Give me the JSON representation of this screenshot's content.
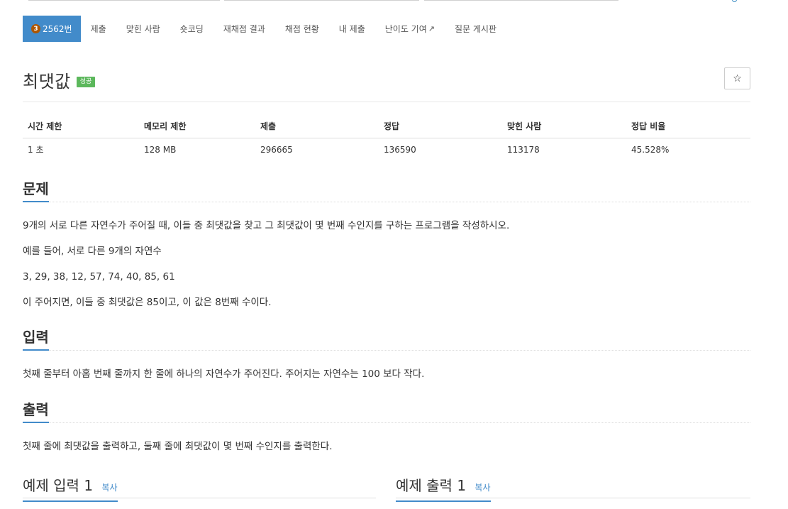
{
  "nav": {
    "tier_label": "3",
    "problem_number": "2562번",
    "items": [
      "제출",
      "맞힌 사람",
      "숏코딩",
      "재채점 결과",
      "채점 현황",
      "내 제출",
      "난이도 기여",
      "질문 게시판"
    ],
    "external_icon": "external-link-icon",
    "active_color": "#428bca",
    "tier_color": "#ad5600"
  },
  "problem": {
    "title": "최댓값",
    "badge": "성공",
    "badge_color": "#5cb85c",
    "star_label": "☆"
  },
  "stats": {
    "headers": [
      "시간 제한",
      "메모리 제한",
      "제출",
      "정답",
      "맞힌 사람",
      "정답 비율"
    ],
    "values": [
      "1 초",
      "128 MB",
      "296665",
      "136590",
      "113178",
      "45.528%"
    ]
  },
  "sections": {
    "problem": {
      "title": "문제",
      "paragraphs": [
        "9개의 서로 다른 자연수가 주어질 때, 이들 중 최댓값을 찾고 그 최댓값이 몇 번째 수인지를 구하는 프로그램을 작성하시오.",
        "예를 들어, 서로 다른 9개의 자연수",
        "3, 29, 38, 12, 57, 74, 40, 85, 61",
        "이 주어지면, 이들 중 최댓값은 85이고, 이 값은 8번째 수이다."
      ]
    },
    "input": {
      "title": "입력",
      "paragraphs": [
        "첫째 줄부터 아홉 번째 줄까지 한 줄에 하나의 자연수가 주어진다. 주어지는 자연수는 100 보다 작다."
      ]
    },
    "output": {
      "title": "출력",
      "paragraphs": [
        "첫째 줄에 최댓값을 출력하고, 둘째 줄에 최댓값이 몇 번째 수인지를 출력한다."
      ]
    }
  },
  "samples": {
    "input_title": "예제 입력 1",
    "output_title": "예제 출력 1",
    "copy_label": "복사"
  }
}
